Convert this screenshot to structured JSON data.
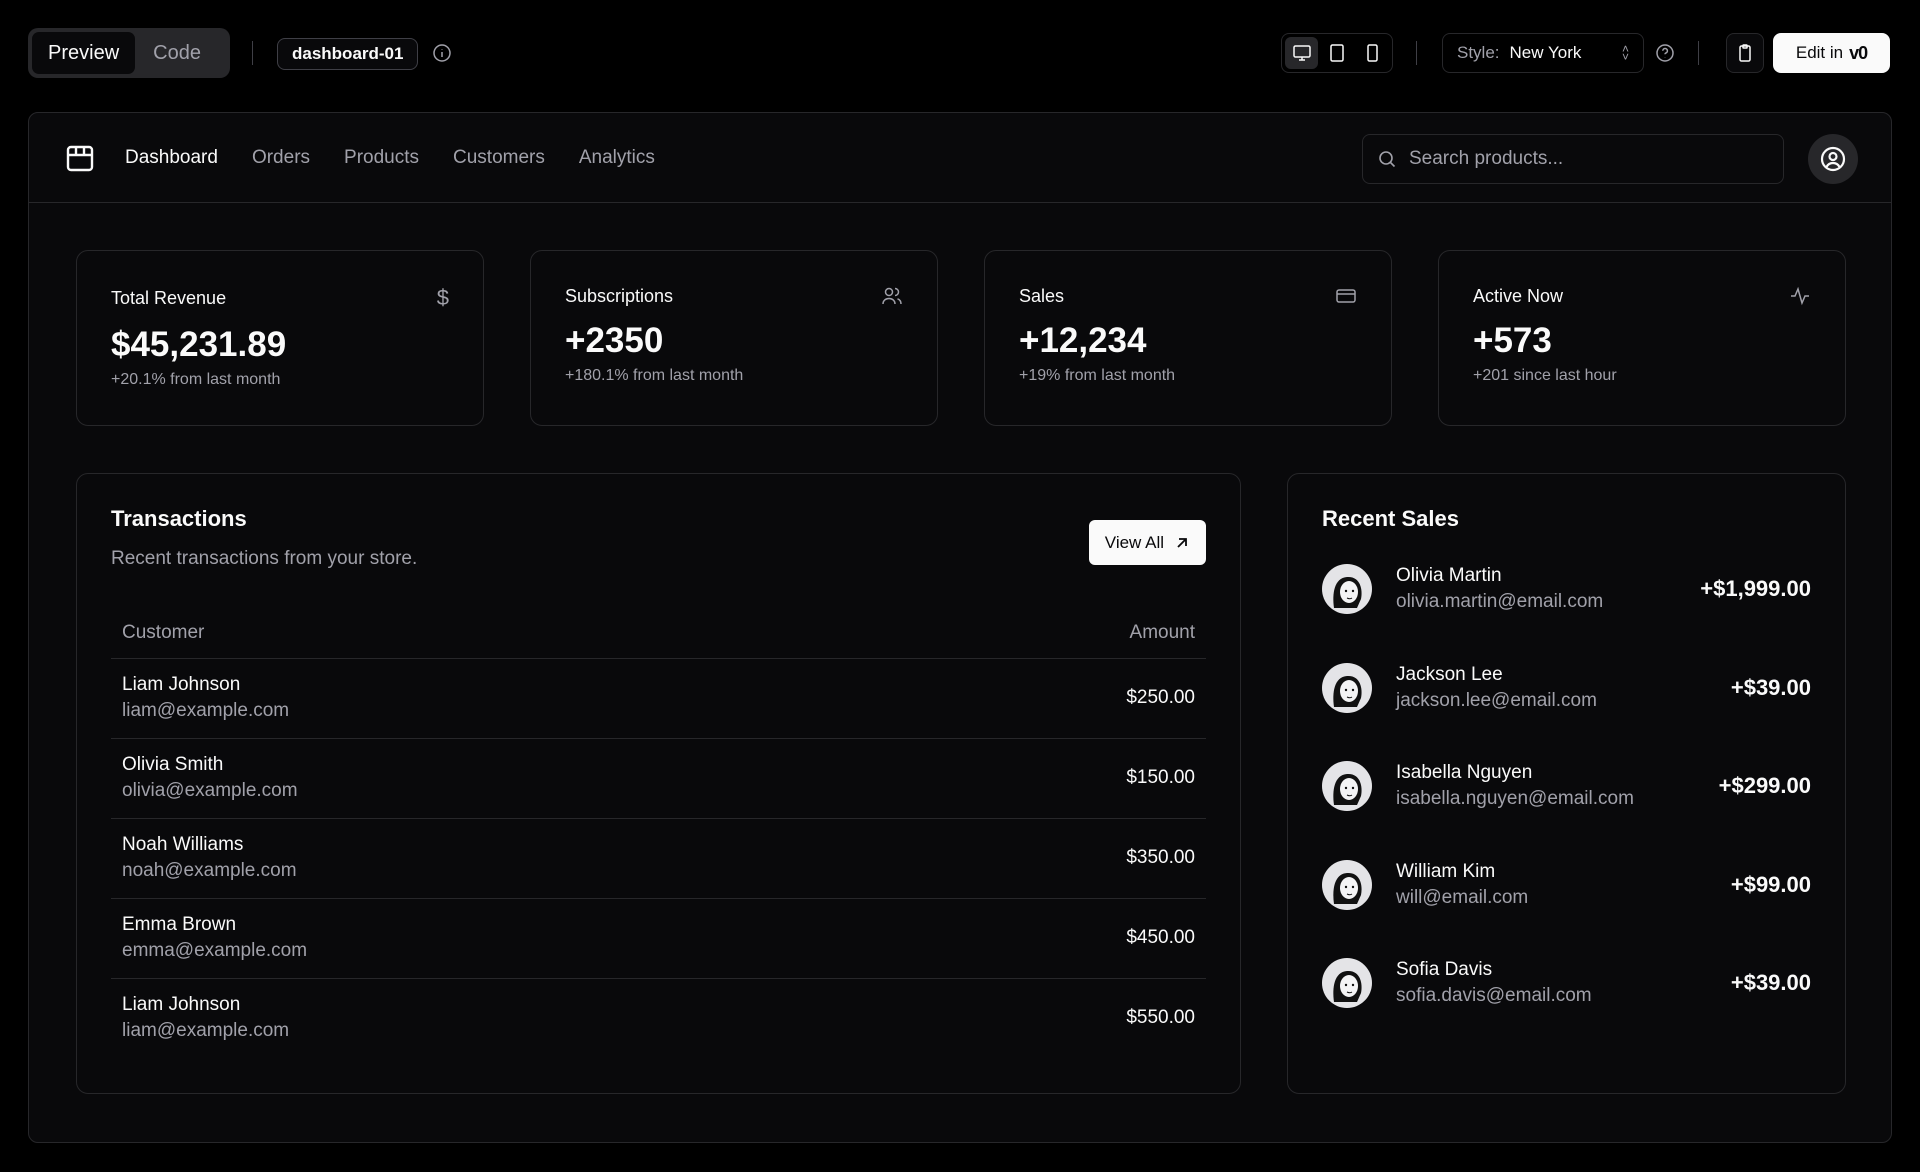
{
  "toolbar": {
    "preview": "Preview",
    "code": "Code",
    "block_name": "dashboard-01",
    "style_label": "Style:",
    "style_value": "New York",
    "edit_label": "Edit in",
    "edit_brand": "v0"
  },
  "nav": {
    "links": [
      "Dashboard",
      "Orders",
      "Products",
      "Customers",
      "Analytics"
    ],
    "active": "Dashboard",
    "search_placeholder": "Search products..."
  },
  "stats": [
    {
      "title": "Total Revenue",
      "value": "$45,231.89",
      "sub": "+20.1% from last month",
      "icon": "dollar-icon"
    },
    {
      "title": "Subscriptions",
      "value": "+2350",
      "sub": "+180.1% from last month",
      "icon": "users-icon"
    },
    {
      "title": "Sales",
      "value": "+12,234",
      "sub": "+19% from last month",
      "icon": "credit-card-icon"
    },
    {
      "title": "Active Now",
      "value": "+573",
      "sub": "+201 since last hour",
      "icon": "activity-icon"
    }
  ],
  "transactions": {
    "title": "Transactions",
    "description": "Recent transactions from your store.",
    "view_all": "View All",
    "columns": [
      "Customer",
      "Amount"
    ],
    "rows": [
      {
        "name": "Liam Johnson",
        "email": "liam@example.com",
        "amount": "$250.00"
      },
      {
        "name": "Olivia Smith",
        "email": "olivia@example.com",
        "amount": "$150.00"
      },
      {
        "name": "Noah Williams",
        "email": "noah@example.com",
        "amount": "$350.00"
      },
      {
        "name": "Emma Brown",
        "email": "emma@example.com",
        "amount": "$450.00"
      },
      {
        "name": "Liam Johnson",
        "email": "liam@example.com",
        "amount": "$550.00"
      }
    ]
  },
  "recent_sales": {
    "title": "Recent Sales",
    "items": [
      {
        "name": "Olivia Martin",
        "email": "olivia.martin@email.com",
        "amount": "+$1,999.00"
      },
      {
        "name": "Jackson Lee",
        "email": "jackson.lee@email.com",
        "amount": "+$39.00"
      },
      {
        "name": "Isabella Nguyen",
        "email": "isabella.nguyen@email.com",
        "amount": "+$299.00"
      },
      {
        "name": "William Kim",
        "email": "will@email.com",
        "amount": "+$99.00"
      },
      {
        "name": "Sofia Davis",
        "email": "sofia.davis@email.com",
        "amount": "+$39.00"
      }
    ]
  },
  "colors": {
    "background": "#000000",
    "panel": "#09090b",
    "border": "#27272a",
    "muted": "#a1a1aa",
    "foreground": "#fafafa"
  }
}
